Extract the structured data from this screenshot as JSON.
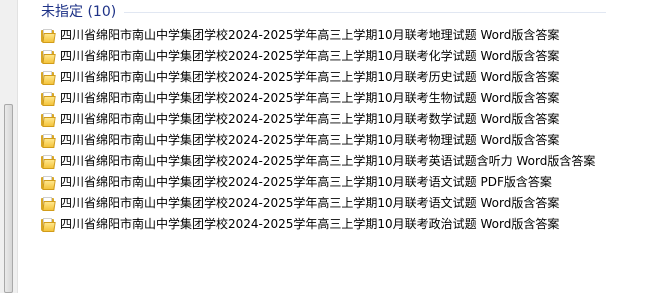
{
  "group": {
    "title": "未指定 (10)"
  },
  "files": [
    {
      "name": "四川省绵阳市南山中学集团学校2024-2025学年高三上学期10月联考地理试题 Word版含答案",
      "icon": "folder-icon"
    },
    {
      "name": "四川省绵阳市南山中学集团学校2024-2025学年高三上学期10月联考化学试题 Word版含答案",
      "icon": "folder-icon"
    },
    {
      "name": "四川省绵阳市南山中学集团学校2024-2025学年高三上学期10月联考历史试题 Word版含答案",
      "icon": "folder-icon"
    },
    {
      "name": "四川省绵阳市南山中学集团学校2024-2025学年高三上学期10月联考生物试题 Word版含答案",
      "icon": "folder-icon"
    },
    {
      "name": "四川省绵阳市南山中学集团学校2024-2025学年高三上学期10月联考数学试题 Word版含答案",
      "icon": "folder-icon"
    },
    {
      "name": "四川省绵阳市南山中学集团学校2024-2025学年高三上学期10月联考物理试题 Word版含答案",
      "icon": "folder-icon"
    },
    {
      "name": "四川省绵阳市南山中学集团学校2024-2025学年高三上学期10月联考英语试题含听力 Word版含答案",
      "icon": "folder-icon"
    },
    {
      "name": "四川省绵阳市南山中学集团学校2024-2025学年高三上学期10月联考语文试题 PDF版含答案",
      "icon": "folder-icon"
    },
    {
      "name": "四川省绵阳市南山中学集团学校2024-2025学年高三上学期10月联考语文试题 Word版含答案",
      "icon": "folder-icon"
    },
    {
      "name": "四川省绵阳市南山中学集团学校2024-2025学年高三上学期10月联考政治试题 Word版含答案",
      "icon": "folder-icon"
    }
  ],
  "colors": {
    "group_header": "#1e3287",
    "folder": "#f4c43c"
  }
}
